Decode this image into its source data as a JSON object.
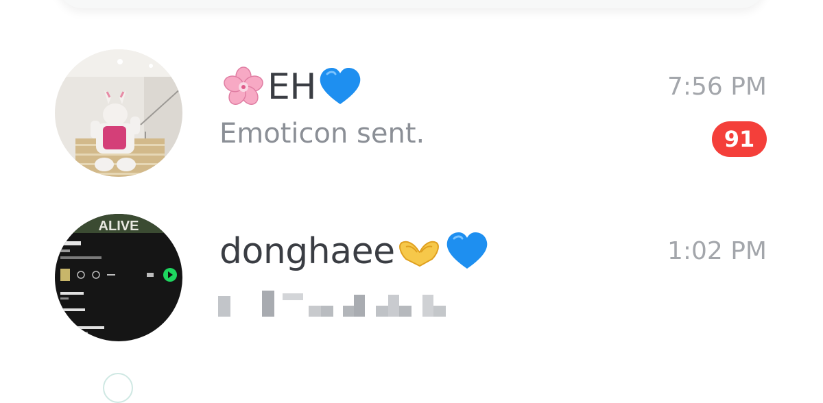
{
  "chats": [
    {
      "name": "EH",
      "name_prefix_icon": "cherry-blossom-emoji",
      "name_suffix_icon": "blue-heart-emoji",
      "preview": "Emoticon sent.",
      "time": "7:56 PM",
      "unread": "91",
      "badge_color": "#f43f3a"
    },
    {
      "name": "donghaee",
      "name_suffix_icons": [
        "heart-hands-emoji",
        "blue-heart-emoji"
      ],
      "preview_obscured": true,
      "time": "1:02 PM",
      "avatar_text": "ALIVE"
    }
  ],
  "colors": {
    "name": "#3a3d43",
    "preview": "#8b8f96",
    "time": "#a3a6ab",
    "background": "#ffffff"
  }
}
